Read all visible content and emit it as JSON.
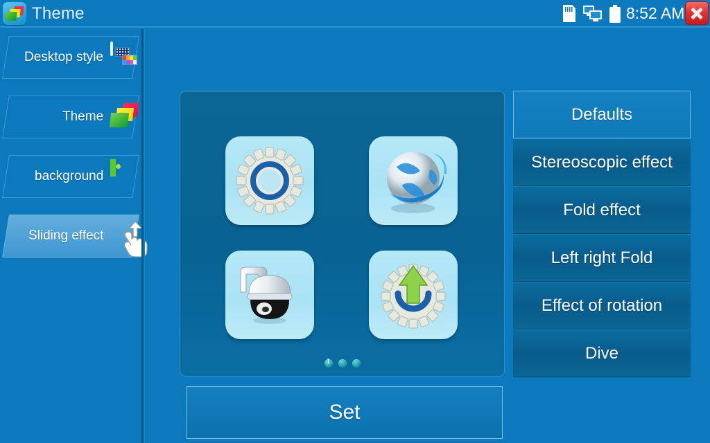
{
  "titlebar": {
    "app_icon": "theme-app-icon",
    "title": "Theme",
    "clock": "8:52 AM",
    "status_icons": [
      "sd-card-icon",
      "network-monitor-icon",
      "battery-icon"
    ],
    "close_label": "close-icon"
  },
  "sidebar": {
    "items": [
      {
        "label": "Desktop style",
        "icon": "desktop-style-icon",
        "selected": false
      },
      {
        "label": "Theme",
        "icon": "theme-icon",
        "selected": false
      },
      {
        "label": "background",
        "icon": "background-image-icon",
        "selected": false
      },
      {
        "label": "Sliding effect",
        "icon": "hand-tap-cursor-icon",
        "selected": true
      }
    ]
  },
  "center_panel": {
    "tiles": [
      {
        "icon": "gear-settings-icon"
      },
      {
        "icon": "globe-network-icon"
      },
      {
        "icon": "ptz-dome-camera-icon"
      },
      {
        "icon": "gear-upgrade-icon"
      }
    ],
    "page_dots": {
      "count": 3,
      "active_index": 0,
      "active_label": "1"
    }
  },
  "right_menu": {
    "options": [
      {
        "label": "Defaults",
        "selected": true
      },
      {
        "label": "Stereoscopic effect",
        "selected": false
      },
      {
        "label": "Fold effect",
        "selected": false
      },
      {
        "label": "Left right Fold",
        "selected": false
      },
      {
        "label": "Effect of rotation",
        "selected": false
      },
      {
        "label": "Dive",
        "selected": false
      }
    ]
  },
  "actions": {
    "set_label": "Set"
  },
  "colors": {
    "background": "#0c79bd",
    "panel": "#086293",
    "selected_item": "#3f97d2",
    "menu_button": "#0a6694",
    "close_button": "#e53232",
    "tile": "#a9e3f4"
  }
}
